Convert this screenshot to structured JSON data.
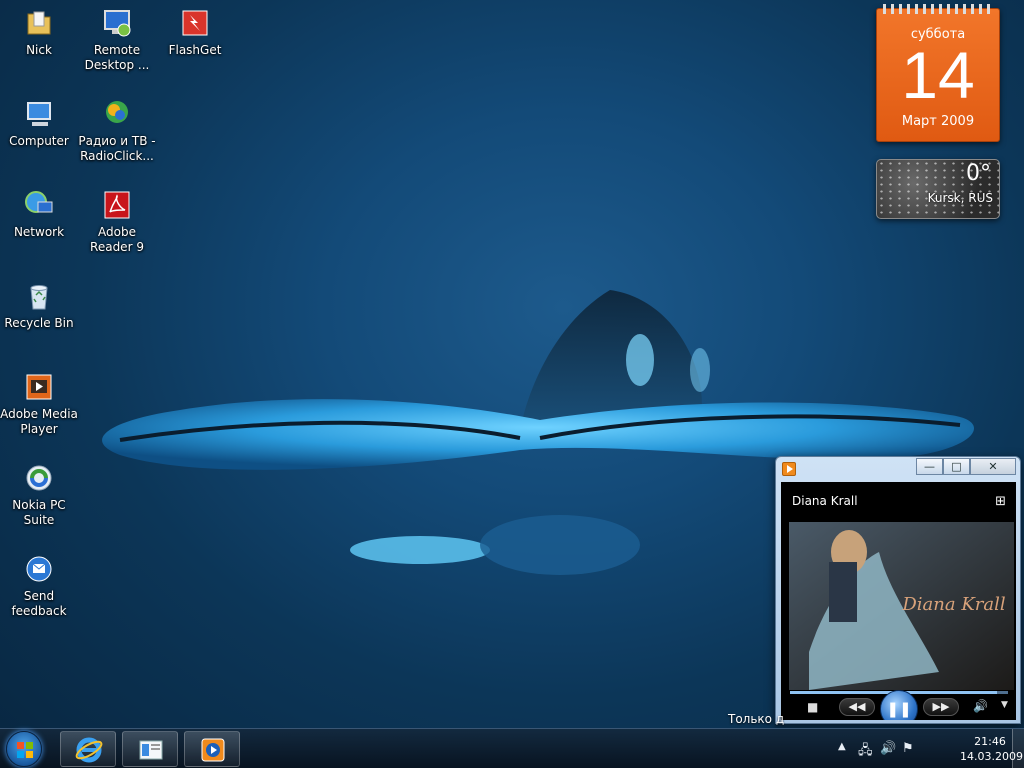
{
  "desktop_icons": [
    {
      "label": "Nick",
      "icon": "folder-icon"
    },
    {
      "label": "Remote Desktop ...",
      "icon": "remote-desktop-icon"
    },
    {
      "label": "FlashGet",
      "icon": "flashget-icon"
    },
    {
      "label": "Computer",
      "icon": "computer-icon"
    },
    {
      "label": "Радио и ТВ - RadioClick...",
      "icon": "radioclick-icon"
    },
    {
      "label": "Network",
      "icon": "network-icon"
    },
    {
      "label": "Adobe Reader 9",
      "icon": "adobe-reader-icon"
    },
    {
      "label": "Recycle Bin",
      "icon": "recycle-bin-icon"
    },
    {
      "label": "Adobe Media Player",
      "icon": "adobe-media-player-icon"
    },
    {
      "label": "Nokia PC Suite",
      "icon": "nokia-pc-suite-icon"
    },
    {
      "label": "Send feedback",
      "icon": "send-feedback-icon"
    }
  ],
  "calendar": {
    "weekday": "суббота",
    "day": "14",
    "month_year": "Март 2009"
  },
  "weather": {
    "temperature": "0°",
    "location": "Kursk, RUS"
  },
  "media_player": {
    "artist": "Diana Krall",
    "album_cover_text": "Diana Krall",
    "window_buttons": {
      "minimize": "—",
      "maximize": "□",
      "close": "✕"
    },
    "controls": {
      "stop": "■",
      "previous": "◀◀",
      "play_pause": "❚❚",
      "next": "▶▶",
      "volume": "🔊"
    },
    "progress": 0.95
  },
  "watermark": "Только д",
  "taskbar": {
    "buttons": [
      {
        "name": "internet-explorer",
        "icon": "internet-explorer-icon"
      },
      {
        "name": "windows-explorer",
        "icon": "explorer-icon"
      },
      {
        "name": "windows-media-player",
        "icon": "media-player-icon"
      }
    ],
    "tray": {
      "time": "21:46",
      "date": "14.03.2009"
    }
  },
  "colors": {
    "calendar_orange": "#e8651c",
    "taskbar": "#0e1e30",
    "wallpaper": "#134a78"
  }
}
